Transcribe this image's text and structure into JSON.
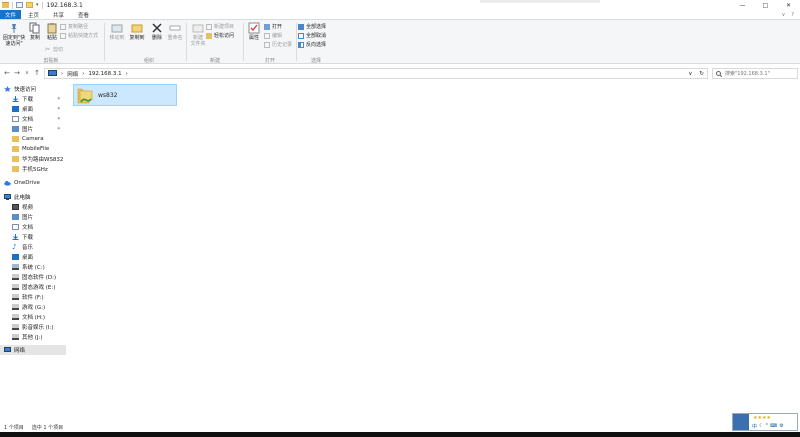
{
  "window": {
    "title": "192.168.3.1",
    "dropdown_glyph": "▾",
    "controls": {
      "minimize": "—",
      "maximize": "□",
      "close": "✕"
    }
  },
  "ribbon_tabs": {
    "file": "文件",
    "home": "主页",
    "share": "共享",
    "view": "查看",
    "expand": "∨",
    "help": "?"
  },
  "ribbon": {
    "clipboard": {
      "label": "剪贴板",
      "pin": "固定到\"快速访问\"",
      "copy": "复制",
      "paste": "粘贴",
      "copy_path": "复制路径",
      "paste_shortcut": "粘贴快捷方式",
      "cut": "剪切"
    },
    "organize": {
      "label": "组织",
      "move_to": "移动到",
      "copy_to": "复制到",
      "delete": "删除",
      "rename": "重命名"
    },
    "new": {
      "label": "新建",
      "new_folder": "新建\n文件夹",
      "new_item": "新建项目",
      "easy_access": "轻松访问"
    },
    "open": {
      "label": "打开",
      "properties": "属性",
      "open": "打开",
      "edit": "编辑",
      "history": "历史记录"
    },
    "select": {
      "label": "选择",
      "select_all": "全部选择",
      "select_none": "全部取消",
      "invert": "反向选择"
    }
  },
  "address": {
    "back": "←",
    "forward": "→",
    "recent": "∨",
    "up": "↑",
    "root": "网络",
    "current": "192.168.3.1",
    "sep": "›",
    "dropdown": "∨",
    "refresh": "↻",
    "search_placeholder": "搜索\"192.168.3.1\""
  },
  "nav": {
    "quick_access": "快速访问",
    "quick_items": [
      "下载",
      "桌面",
      "文档",
      "图片"
    ],
    "pin": "✶",
    "folders": [
      "Camera",
      "MobileFile",
      "华为路由WS832",
      "手机5GHz"
    ],
    "onedrive": "OneDrive",
    "this_pc": "此电脑",
    "pc_items": [
      "视频",
      "图片",
      "文档",
      "下载",
      "音乐",
      "桌面",
      "系统 (C:)",
      "固态软件 (D:)",
      "固态游戏 (E:)",
      "软件 (F:)",
      "游戏 (G:)",
      "文档 (H:)",
      "影音娱乐 (I:)",
      "其他 (J:)"
    ],
    "network": "网络"
  },
  "content": {
    "items": [
      {
        "name": "ws832"
      }
    ]
  },
  "status": {
    "count": "1 个项目",
    "selected": "选中 1 个项目"
  },
  "colors": {
    "accent": "#1a73c8",
    "selection": "#cce8ff",
    "selection_border": "#99d1ff",
    "folder": "#e9c15b"
  }
}
